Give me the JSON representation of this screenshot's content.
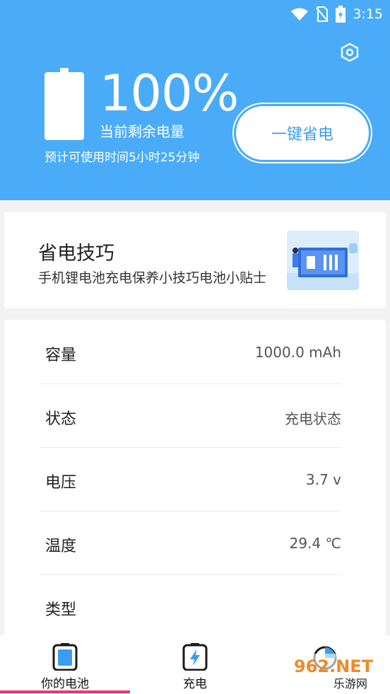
{
  "status_bar": {
    "time": "3:15"
  },
  "header": {
    "percent": "100%",
    "remaining_label": "当前剩余电量",
    "estimate": "预计可使用时间5小时25分钟",
    "save_button": "一键省电"
  },
  "tips": {
    "title": "省电技巧",
    "subtitle": "手机锂电池充电保养小技巧电池小贴士"
  },
  "info": {
    "rows": [
      {
        "label": "容量",
        "value": "1000.0 mAh"
      },
      {
        "label": "状态",
        "value": "充电状态"
      },
      {
        "label": "电压",
        "value": "3.7 v"
      },
      {
        "label": "温度",
        "value": "29.4 ℃"
      },
      {
        "label": "类型",
        "value": ""
      }
    ]
  },
  "nav": {
    "items": [
      {
        "label": "你的电池",
        "icon": "battery-icon"
      },
      {
        "label": "充电",
        "icon": "charging-icon"
      },
      {
        "label": "",
        "icon": "pie-chart-icon"
      }
    ]
  },
  "watermark": {
    "text": "962.NET",
    "sub": "乐游网"
  },
  "colors": {
    "accent": "#4aacf8",
    "indicator": "#e8386e"
  }
}
